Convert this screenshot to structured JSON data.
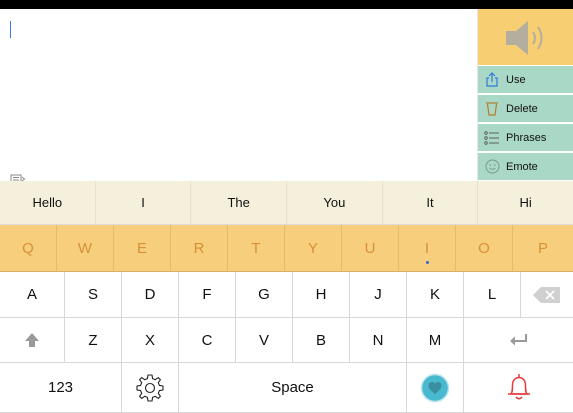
{
  "predictions": [
    "Hello",
    "I",
    "The",
    "You",
    "It",
    "Hi"
  ],
  "side_actions": [
    {
      "label": "Use",
      "icon": "share-icon"
    },
    {
      "label": "Delete",
      "icon": "trash-icon"
    },
    {
      "label": "Phrases",
      "icon": "list-icon"
    },
    {
      "label": "Emote",
      "icon": "smiley-icon"
    }
  ],
  "keyboard": {
    "row1": [
      "Q",
      "W",
      "E",
      "R",
      "T",
      "Y",
      "U",
      "I",
      "O",
      "P"
    ],
    "row2": [
      "A",
      "S",
      "D",
      "F",
      "G",
      "H",
      "J",
      "K",
      "L"
    ],
    "row3": [
      "Z",
      "X",
      "C",
      "V",
      "B",
      "N",
      "M"
    ],
    "numbers_label": "123",
    "space_label": "Space"
  },
  "colors": {
    "speak_bg": "#f8ce72",
    "action_bg": "#a9d8c6",
    "top_row_bg": "#f7cf7c",
    "prediction_bg": "#f5f0dc",
    "alert_red": "#e53b3b",
    "heart_teal": "#49b9cf"
  }
}
